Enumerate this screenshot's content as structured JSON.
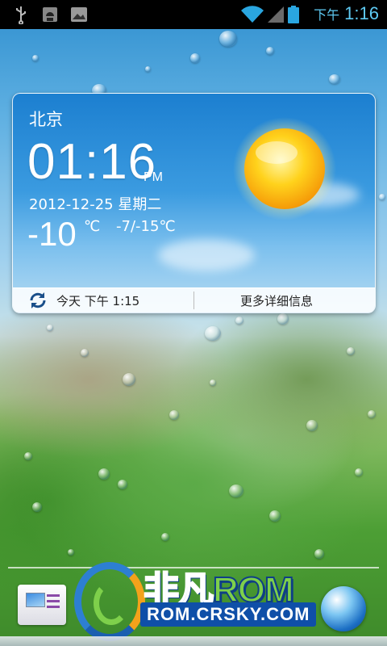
{
  "status_bar": {
    "time_ampm": "下午",
    "time": "1:16",
    "icons": [
      "usb-icon",
      "android-debug-icon",
      "image-notification-icon",
      "wifi-icon",
      "signal-icon",
      "battery-icon"
    ]
  },
  "weather_widget": {
    "city": "北京",
    "time": "01:16",
    "ampm": "PM",
    "date": "2012-12-25  星期二",
    "temperature_current": "-10",
    "temperature_unit": "℃",
    "temperature_range": "-7/-15℃",
    "condition_icon": "sun-icon",
    "updated_label": "今天 下午 1:15",
    "more_details_label": "更多详细信息"
  },
  "dock": {
    "apps": [
      {
        "name": "messaging",
        "icon": "messaging-icon"
      },
      {
        "name": "browser",
        "icon": "globe-icon"
      }
    ]
  },
  "watermark": {
    "title_cn": "非凡",
    "title_en": "ROM",
    "url": "ROM.CRSKY.COM"
  },
  "colors": {
    "status_time": "#5ecaf3",
    "wifi": "#2aa6e0",
    "widget_top": "#1c7fd0",
    "watermark_blue": "#2d7fd2",
    "watermark_green": "#7ed04b"
  }
}
